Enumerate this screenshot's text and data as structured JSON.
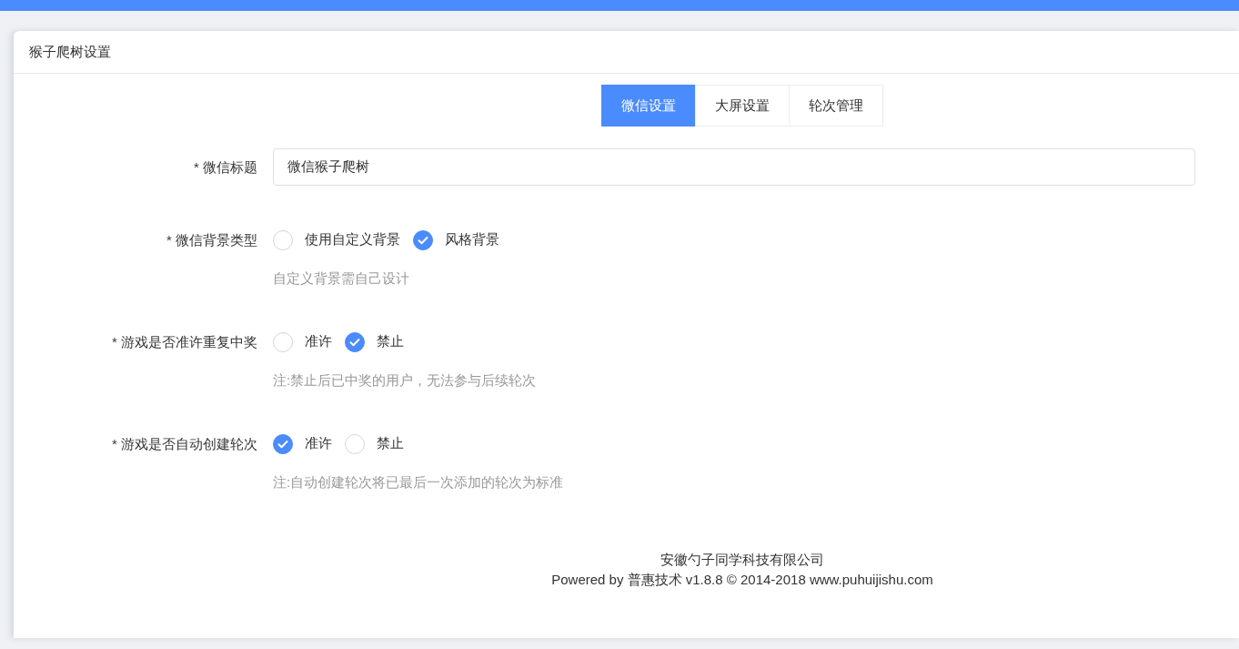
{
  "card": {
    "title": "猴子爬树设置"
  },
  "tabs": [
    {
      "label": "微信设置",
      "selected": true
    },
    {
      "label": "大屏设置",
      "selected": false
    },
    {
      "label": "轮次管理",
      "selected": false
    }
  ],
  "fields": [
    {
      "kind": "input",
      "label": "* 微信标题",
      "value": "微信猴子爬树"
    },
    {
      "kind": "radio",
      "label": "* 微信背景类型",
      "options": [
        {
          "label": "使用自定义背景",
          "selected": false
        },
        {
          "label": "风格背景",
          "selected": true
        }
      ],
      "hint": "自定义背景需自己设计"
    },
    {
      "kind": "radio",
      "label": "* 游戏是否准许重复中奖",
      "options": [
        {
          "label": "准许",
          "selected": false
        },
        {
          "label": "禁止",
          "selected": true
        }
      ],
      "hint": "注:禁止后已中奖的用户，无法参与后续轮次"
    },
    {
      "kind": "radio",
      "label": "* 游戏是否自动创建轮次",
      "options": [
        {
          "label": "准许",
          "selected": true
        },
        {
          "label": "禁止",
          "selected": false
        }
      ],
      "hint": "注:自动创建轮次将已最后一次添加的轮次为标准"
    }
  ],
  "footer": {
    "company": "安徽勺子同学科技有限公司",
    "powered": "Powered by 普惠技术 v1.8.8 © 2014-2018 www.puhuijishu.com"
  }
}
